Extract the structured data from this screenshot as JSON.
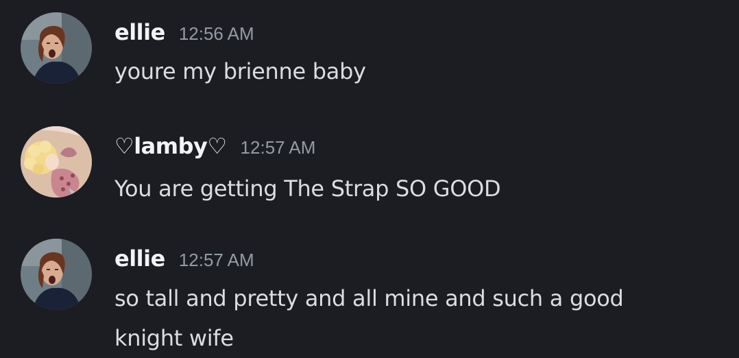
{
  "messages": [
    {
      "username": "ellie",
      "timestamp": "12:56 AM",
      "text": "youre my brienne baby",
      "avatar_icon": "ellie-avatar"
    },
    {
      "username": "♡lamby♡",
      "timestamp": "12:57 AM",
      "text": "You are getting The Strap SO GOOD",
      "avatar_icon": "lamby-avatar"
    },
    {
      "username": "ellie",
      "timestamp": "12:57 AM",
      "text": "so tall and pretty and all mine and such a good\nknight wife",
      "avatar_icon": "ellie-avatar"
    }
  ],
  "colors": {
    "background": "#1c1d23",
    "username": "#f2f3f5",
    "timestamp": "#949ba4",
    "message_text": "#dbdee1"
  }
}
